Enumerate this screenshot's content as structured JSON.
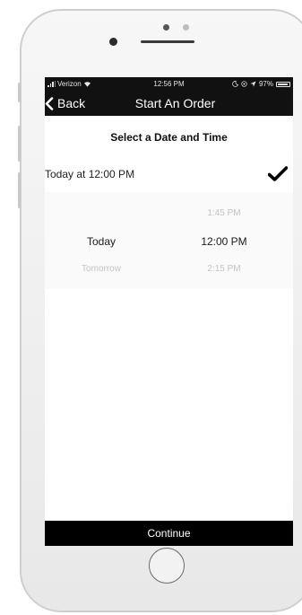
{
  "status_bar": {
    "carrier": "Verizon",
    "time": "12:56 PM",
    "battery": "97%"
  },
  "nav": {
    "back_label": "Back",
    "title": "Start An Order"
  },
  "section_title": "Select a Date and Time",
  "selected": {
    "text": "Today at 12:00 PM"
  },
  "picker": {
    "dates": {
      "selected": "Today",
      "next": "Tomorrow"
    },
    "times": {
      "previous": "1:45 PM",
      "selected": "12:00 PM",
      "next": "2:15 PM"
    }
  },
  "continue_label": "Continue",
  "colors": {
    "header_bg": "#111111",
    "button_bg": "#000000"
  }
}
